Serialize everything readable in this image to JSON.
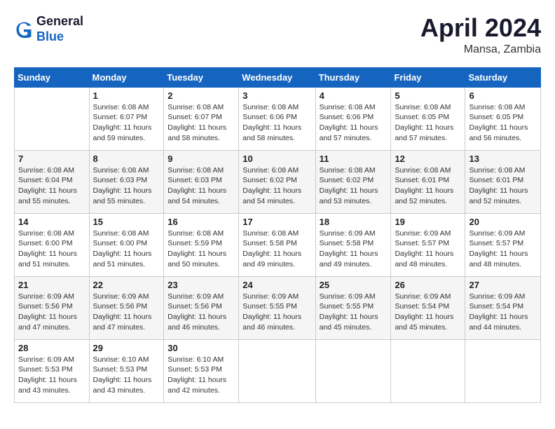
{
  "header": {
    "logo_line1": "General",
    "logo_line2": "Blue",
    "month": "April 2024",
    "location": "Mansa, Zambia"
  },
  "columns": [
    "Sunday",
    "Monday",
    "Tuesday",
    "Wednesday",
    "Thursday",
    "Friday",
    "Saturday"
  ],
  "weeks": [
    [
      {
        "day": "",
        "sunrise": "",
        "sunset": "",
        "daylight": ""
      },
      {
        "day": "1",
        "sunrise": "Sunrise: 6:08 AM",
        "sunset": "Sunset: 6:07 PM",
        "daylight": "Daylight: 11 hours and 59 minutes."
      },
      {
        "day": "2",
        "sunrise": "Sunrise: 6:08 AM",
        "sunset": "Sunset: 6:07 PM",
        "daylight": "Daylight: 11 hours and 58 minutes."
      },
      {
        "day": "3",
        "sunrise": "Sunrise: 6:08 AM",
        "sunset": "Sunset: 6:06 PM",
        "daylight": "Daylight: 11 hours and 58 minutes."
      },
      {
        "day": "4",
        "sunrise": "Sunrise: 6:08 AM",
        "sunset": "Sunset: 6:06 PM",
        "daylight": "Daylight: 11 hours and 57 minutes."
      },
      {
        "day": "5",
        "sunrise": "Sunrise: 6:08 AM",
        "sunset": "Sunset: 6:05 PM",
        "daylight": "Daylight: 11 hours and 57 minutes."
      },
      {
        "day": "6",
        "sunrise": "Sunrise: 6:08 AM",
        "sunset": "Sunset: 6:05 PM",
        "daylight": "Daylight: 11 hours and 56 minutes."
      }
    ],
    [
      {
        "day": "7",
        "sunrise": "Sunrise: 6:08 AM",
        "sunset": "Sunset: 6:04 PM",
        "daylight": "Daylight: 11 hours and 55 minutes."
      },
      {
        "day": "8",
        "sunrise": "Sunrise: 6:08 AM",
        "sunset": "Sunset: 6:03 PM",
        "daylight": "Daylight: 11 hours and 55 minutes."
      },
      {
        "day": "9",
        "sunrise": "Sunrise: 6:08 AM",
        "sunset": "Sunset: 6:03 PM",
        "daylight": "Daylight: 11 hours and 54 minutes."
      },
      {
        "day": "10",
        "sunrise": "Sunrise: 6:08 AM",
        "sunset": "Sunset: 6:02 PM",
        "daylight": "Daylight: 11 hours and 54 minutes."
      },
      {
        "day": "11",
        "sunrise": "Sunrise: 6:08 AM",
        "sunset": "Sunset: 6:02 PM",
        "daylight": "Daylight: 11 hours and 53 minutes."
      },
      {
        "day": "12",
        "sunrise": "Sunrise: 6:08 AM",
        "sunset": "Sunset: 6:01 PM",
        "daylight": "Daylight: 11 hours and 52 minutes."
      },
      {
        "day": "13",
        "sunrise": "Sunrise: 6:08 AM",
        "sunset": "Sunset: 6:01 PM",
        "daylight": "Daylight: 11 hours and 52 minutes."
      }
    ],
    [
      {
        "day": "14",
        "sunrise": "Sunrise: 6:08 AM",
        "sunset": "Sunset: 6:00 PM",
        "daylight": "Daylight: 11 hours and 51 minutes."
      },
      {
        "day": "15",
        "sunrise": "Sunrise: 6:08 AM",
        "sunset": "Sunset: 6:00 PM",
        "daylight": "Daylight: 11 hours and 51 minutes."
      },
      {
        "day": "16",
        "sunrise": "Sunrise: 6:08 AM",
        "sunset": "Sunset: 5:59 PM",
        "daylight": "Daylight: 11 hours and 50 minutes."
      },
      {
        "day": "17",
        "sunrise": "Sunrise: 6:08 AM",
        "sunset": "Sunset: 5:58 PM",
        "daylight": "Daylight: 11 hours and 49 minutes."
      },
      {
        "day": "18",
        "sunrise": "Sunrise: 6:09 AM",
        "sunset": "Sunset: 5:58 PM",
        "daylight": "Daylight: 11 hours and 49 minutes."
      },
      {
        "day": "19",
        "sunrise": "Sunrise: 6:09 AM",
        "sunset": "Sunset: 5:57 PM",
        "daylight": "Daylight: 11 hours and 48 minutes."
      },
      {
        "day": "20",
        "sunrise": "Sunrise: 6:09 AM",
        "sunset": "Sunset: 5:57 PM",
        "daylight": "Daylight: 11 hours and 48 minutes."
      }
    ],
    [
      {
        "day": "21",
        "sunrise": "Sunrise: 6:09 AM",
        "sunset": "Sunset: 5:56 PM",
        "daylight": "Daylight: 11 hours and 47 minutes."
      },
      {
        "day": "22",
        "sunrise": "Sunrise: 6:09 AM",
        "sunset": "Sunset: 5:56 PM",
        "daylight": "Daylight: 11 hours and 47 minutes."
      },
      {
        "day": "23",
        "sunrise": "Sunrise: 6:09 AM",
        "sunset": "Sunset: 5:56 PM",
        "daylight": "Daylight: 11 hours and 46 minutes."
      },
      {
        "day": "24",
        "sunrise": "Sunrise: 6:09 AM",
        "sunset": "Sunset: 5:55 PM",
        "daylight": "Daylight: 11 hours and 46 minutes."
      },
      {
        "day": "25",
        "sunrise": "Sunrise: 6:09 AM",
        "sunset": "Sunset: 5:55 PM",
        "daylight": "Daylight: 11 hours and 45 minutes."
      },
      {
        "day": "26",
        "sunrise": "Sunrise: 6:09 AM",
        "sunset": "Sunset: 5:54 PM",
        "daylight": "Daylight: 11 hours and 45 minutes."
      },
      {
        "day": "27",
        "sunrise": "Sunrise: 6:09 AM",
        "sunset": "Sunset: 5:54 PM",
        "daylight": "Daylight: 11 hours and 44 minutes."
      }
    ],
    [
      {
        "day": "28",
        "sunrise": "Sunrise: 6:09 AM",
        "sunset": "Sunset: 5:53 PM",
        "daylight": "Daylight: 11 hours and 43 minutes."
      },
      {
        "day": "29",
        "sunrise": "Sunrise: 6:10 AM",
        "sunset": "Sunset: 5:53 PM",
        "daylight": "Daylight: 11 hours and 43 minutes."
      },
      {
        "day": "30",
        "sunrise": "Sunrise: 6:10 AM",
        "sunset": "Sunset: 5:53 PM",
        "daylight": "Daylight: 11 hours and 42 minutes."
      },
      {
        "day": "",
        "sunrise": "",
        "sunset": "",
        "daylight": ""
      },
      {
        "day": "",
        "sunrise": "",
        "sunset": "",
        "daylight": ""
      },
      {
        "day": "",
        "sunrise": "",
        "sunset": "",
        "daylight": ""
      },
      {
        "day": "",
        "sunrise": "",
        "sunset": "",
        "daylight": ""
      }
    ]
  ]
}
